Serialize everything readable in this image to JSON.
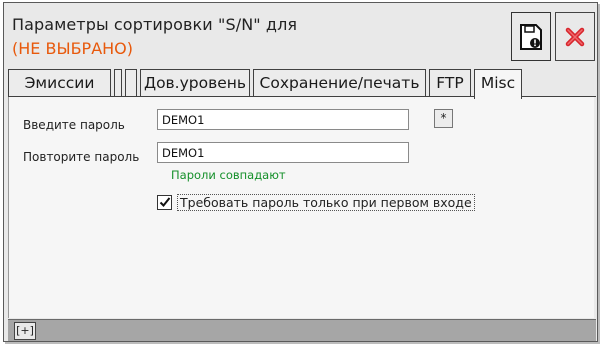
{
  "header": {
    "title_line1": "Параметры сортировки \"S/N\" для",
    "title_line2": "(НЕ ВЫБРАНО)",
    "title_line2_color": "#e8590c",
    "save_icon": "save-icon",
    "close_icon": "close-icon"
  },
  "tabs": [
    {
      "label": "Эмиссии",
      "active": false
    },
    {
      "label": "",
      "active": false
    },
    {
      "label": "Дов.уровень",
      "active": false
    },
    {
      "label": "Сохранение/печать",
      "active": false
    },
    {
      "label": "FTP",
      "active": false
    },
    {
      "label": "Misc",
      "active": true
    }
  ],
  "form": {
    "password_label": "Введите пароль",
    "password_value": "DEMO1",
    "repeat_label": "Повторите пароль",
    "repeat_value": "DEMO1",
    "star_button": "*",
    "match_text": "Пароли совпадают",
    "match_color": "#15902a",
    "checkbox_checked": true,
    "checkbox_label": "Требовать пароль только при первом входе"
  },
  "statusbar": {
    "expand_button": "[+]"
  }
}
